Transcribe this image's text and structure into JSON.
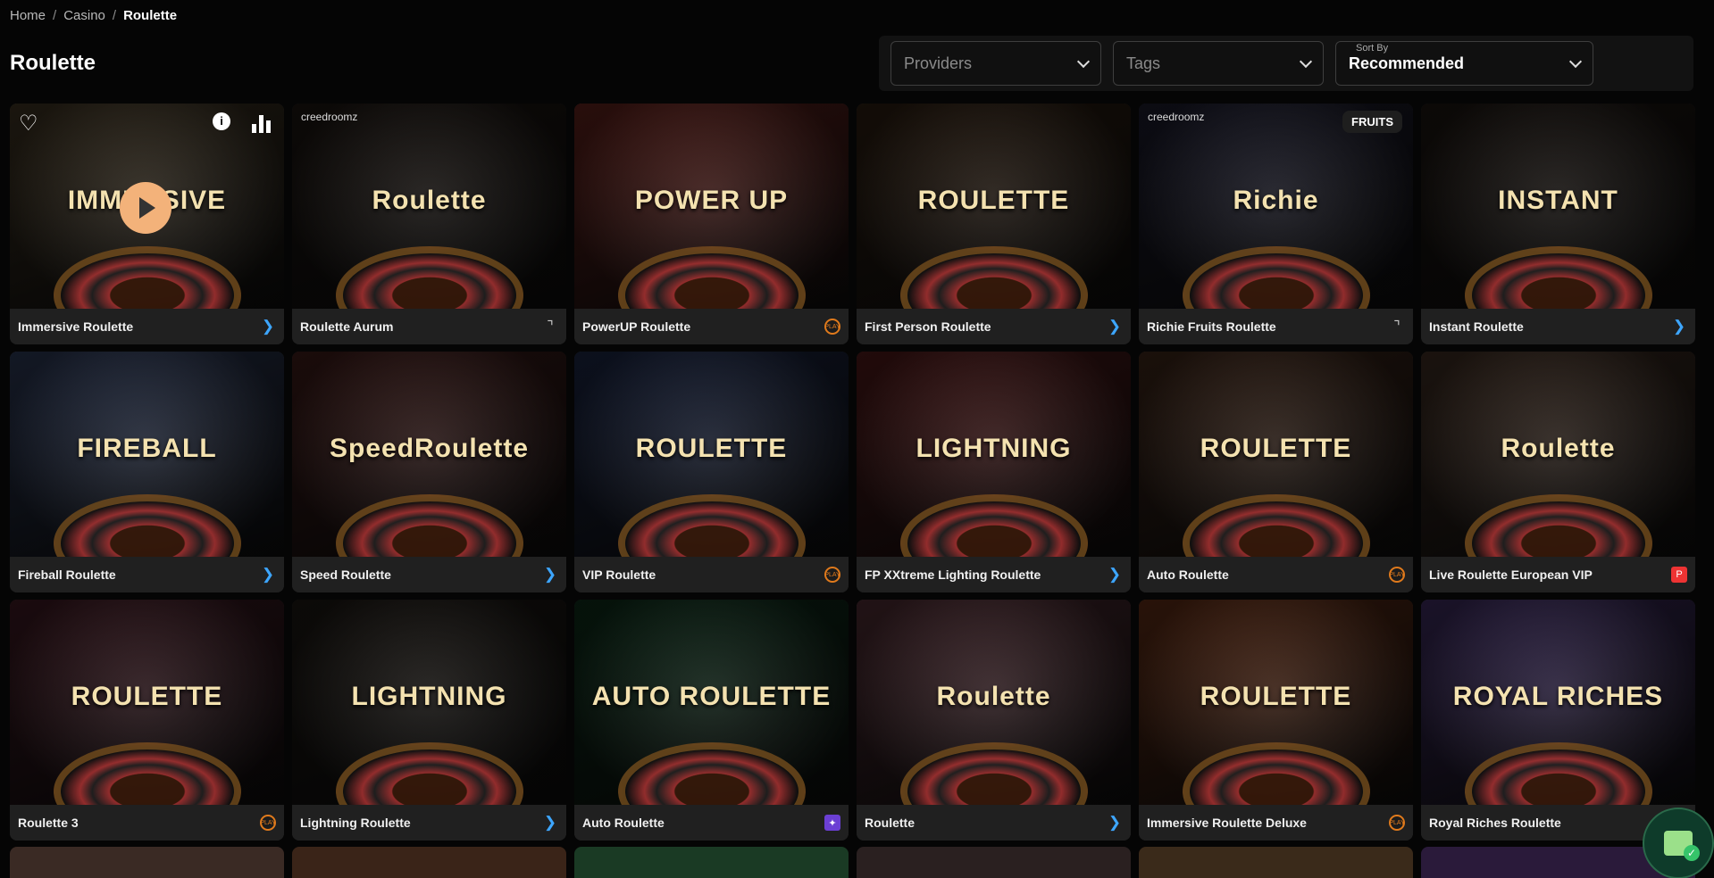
{
  "breadcrumb": {
    "home": "Home",
    "sep": "/",
    "casino": "Casino",
    "current": "Roulette"
  },
  "page": {
    "title": "Roulette"
  },
  "filters": {
    "providers_placeholder": "Providers",
    "tags_placeholder": "Tags",
    "sort_label": "Sort By",
    "sort_value": "Recommended"
  },
  "hover_tile": {
    "info": "i"
  },
  "games": [
    {
      "name": "Immersive Roulette",
      "provider": "evo",
      "art": "IMMERSIVE",
      "bg": "#3a3020"
    },
    {
      "name": "Roulette Aurum",
      "provider": "creed",
      "art": "Roulette",
      "bg": "#1a1410",
      "brand": "creedroomz"
    },
    {
      "name": "PowerUP Roulette",
      "provider": "pp",
      "art": "POWER UP",
      "bg": "#5a1f1a"
    },
    {
      "name": "First Person Roulette",
      "provider": "evo",
      "art": "ROULETTE",
      "bg": "#2a1c10"
    },
    {
      "name": "Richie Fruits Roulette",
      "provider": "creed",
      "art": "Richie",
      "bg": "#1a1a2a",
      "brand": "creedroomz",
      "tag": "FRUITS"
    },
    {
      "name": "Instant Roulette",
      "provider": "evo",
      "art": "INSTANT",
      "bg": "#1a1410"
    },
    {
      "name": "Fireball Roulette",
      "provider": "evo",
      "art": "FIREBALL",
      "bg": "#2a3550"
    },
    {
      "name": "Speed Roulette",
      "provider": "evo",
      "art": "SpeedRoulette",
      "bg": "#3a1a18"
    },
    {
      "name": "VIP Roulette",
      "provider": "pp",
      "art": "ROULETTE",
      "bg": "#1a2440"
    },
    {
      "name": "FP XXtreme Lighting Roulette",
      "provider": "evo",
      "art": "LIGHTNING",
      "bg": "#4a1818"
    },
    {
      "name": "Auto Roulette",
      "provider": "pp",
      "art": "ROULETTE",
      "bg": "#3a2418"
    },
    {
      "name": "Live Roulette European VIP",
      "provider": "red",
      "art": "Roulette",
      "bg": "#3a2a20"
    },
    {
      "name": "Roulette 3",
      "provider": "pp",
      "art": "ROULETTE",
      "bg": "#3a1820"
    },
    {
      "name": "Lightning Roulette",
      "provider": "evo",
      "art": "LIGHTNING",
      "bg": "#1a1612"
    },
    {
      "name": "Auto Roulette",
      "provider": "purple",
      "art": "AUTO ROULETTE",
      "bg": "#0c2a18"
    },
    {
      "name": "Roulette",
      "provider": "evo",
      "art": "Roulette",
      "bg": "#4a2a30"
    },
    {
      "name": "Immersive Roulette Deluxe",
      "provider": "pp",
      "art": "ROULETTE",
      "bg": "#5a2a14"
    },
    {
      "name": "Royal Riches Roulette",
      "provider": "evo",
      "art": "ROYAL RICHES",
      "bg": "#3a2a5a"
    }
  ],
  "provider_marks": {
    "evo": "❯",
    "creed": "⌝",
    "pp": "PLAY",
    "red": "P",
    "purple": "✦"
  },
  "partial_colors": [
    "#3a2a24",
    "#3a2418",
    "#1a3a24",
    "#2a2020",
    "#3a2a1a",
    "#2a1a3a"
  ]
}
